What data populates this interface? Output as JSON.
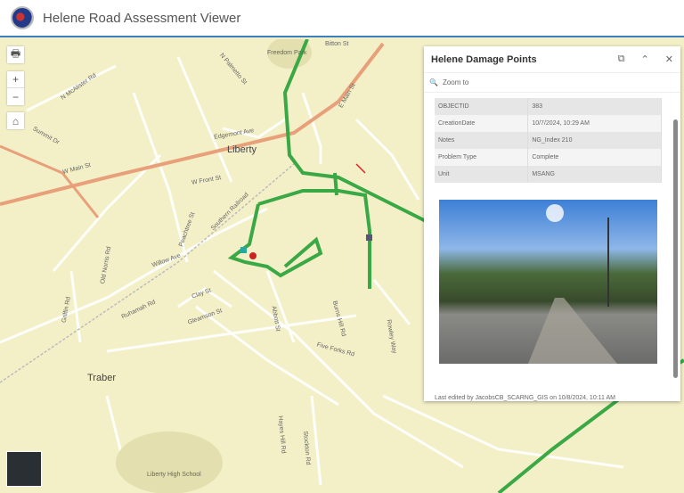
{
  "header": {
    "title": "Helene Road Assessment Viewer"
  },
  "map": {
    "towns": [
      "Liberty",
      "Traber"
    ],
    "streets": [
      "W Main St",
      "Summit Dr",
      "N McAlister Rd",
      "Edgemont Ave",
      "W Front St",
      "E Main St",
      "Peachtree St",
      "Willow Ave",
      "Clay St",
      "Gleamson St",
      "Ruhamah Rd",
      "Five Forks Rd",
      "Burns Hill Rd",
      "Abbott St",
      "Old Norris Rd",
      "Griffin Rd",
      "Hayes Hill Rd",
      "Stockton Rd",
      "Rowley Way",
      "N Palmetto St",
      "Southern Railroad",
      "Bitton St",
      "Freedom Park",
      "Liberty High School"
    ],
    "controls": {
      "print": "🖶",
      "zoom_in": "+",
      "zoom_out": "−",
      "home": "⌂"
    }
  },
  "popup": {
    "title": "Helene Damage Points",
    "zoom_to": "Zoom to",
    "fields": [
      {
        "label": "OBJECTID",
        "value": "383"
      },
      {
        "label": "CreationDate",
        "value": "10/7/2024, 10:29 AM"
      },
      {
        "label": "Notes",
        "value": "NG_Index 210"
      },
      {
        "label": "Problem Type",
        "value": "Complete"
      },
      {
        "label": "Unit",
        "value": "MSANG"
      }
    ],
    "last_edited": "Last edited by JacobsCB_SCARNG_GIS on 10/8/2024, 10:11 AM"
  },
  "colors": {
    "route": "#3aa845",
    "main_road": "#e8a07a",
    "header_border": "#3a7fbf"
  }
}
